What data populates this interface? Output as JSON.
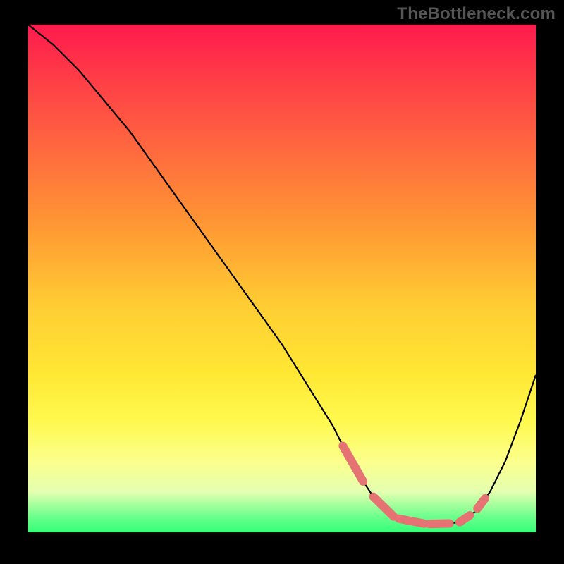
{
  "watermark": "TheBottleneck.com",
  "chart_data": {
    "type": "line",
    "title": "",
    "xlabel": "",
    "ylabel": "",
    "xlim": [
      0,
      100
    ],
    "ylim": [
      0,
      100
    ],
    "series": [
      {
        "name": "curve",
        "x": [
          0,
          5,
          10,
          15,
          20,
          25,
          30,
          35,
          40,
          45,
          50,
          55,
          60,
          62,
          64,
          66,
          68,
          70,
          72,
          74,
          76,
          78,
          80,
          82,
          85,
          88,
          91,
          94,
          97,
          100
        ],
        "y": [
          100,
          96,
          91,
          85,
          79,
          72,
          65,
          58,
          51,
          44,
          37,
          29,
          21,
          17,
          13,
          10,
          7,
          5,
          3.1,
          2.3,
          1.9,
          1.7,
          1.6,
          1.6,
          2.0,
          4,
          8,
          14,
          22,
          31
        ]
      }
    ],
    "markers": {
      "name": "highlight-lumps",
      "color": "#e57373",
      "segments": [
        {
          "x_start": 62,
          "x_end": 66
        },
        {
          "x_start": 68,
          "x_end": 72
        },
        {
          "x_start": 73,
          "x_end": 78
        },
        {
          "x_start": 79,
          "x_end": 83
        },
        {
          "x_start": 85,
          "x_end": 87
        },
        {
          "x_start": 88.5,
          "x_end": 90
        }
      ]
    },
    "background_gradient": {
      "top": "#ff1a4d",
      "bottom": "#33ff77"
    }
  }
}
